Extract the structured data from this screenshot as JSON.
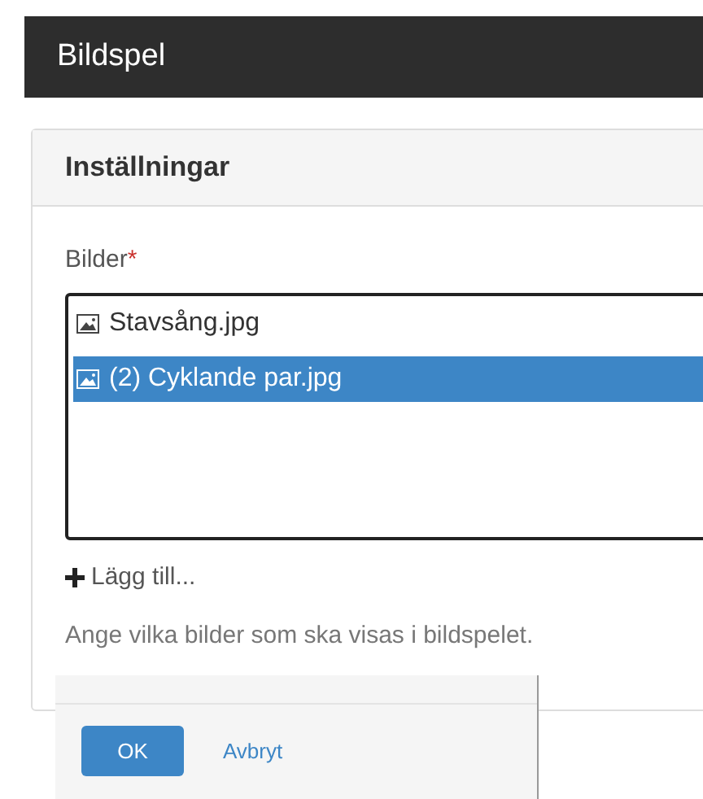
{
  "header": {
    "title": "Bildspel"
  },
  "panel": {
    "title": "Inställningar",
    "field": {
      "label": "Bilder",
      "required_mark": "*",
      "items": [
        {
          "label": "Stavsång.jpg",
          "selected": false
        },
        {
          "label": "(2) Cyklande par.jpg",
          "selected": true
        }
      ],
      "add_label": "Lägg till...",
      "help": "Ange vilka bilder som ska visas i bildspelet."
    }
  },
  "footer": {
    "buttons": [
      {
        "label": "OK",
        "kind": "primary"
      },
      {
        "label": "Avbryt",
        "kind": "link"
      }
    ]
  }
}
